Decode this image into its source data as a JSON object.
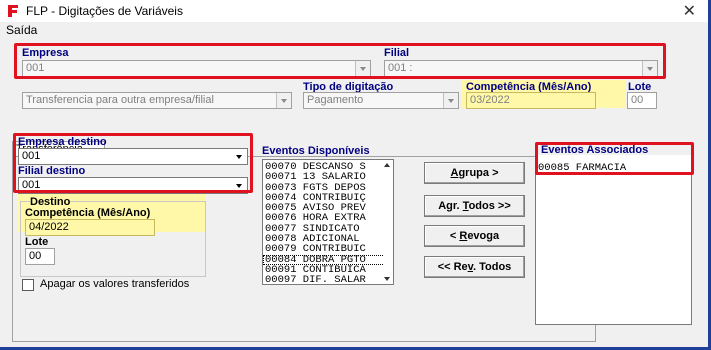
{
  "window": {
    "title": "FLP - Digitações de Variáveis",
    "close_glyph": "✕"
  },
  "menu": {
    "items": [
      "Saída"
    ]
  },
  "empresa": {
    "label": "Empresa",
    "value": "001"
  },
  "filial": {
    "label": "Filial",
    "value": "001 :"
  },
  "operacao": {
    "value": "Transferencia para outra empresa/filial"
  },
  "tipo_digitacao": {
    "label": "Tipo de digitação",
    "value": "Pagamento"
  },
  "competencia": {
    "label": "Competência (Mês/Ano)",
    "value": "03/2022"
  },
  "lote": {
    "label": "Lote",
    "value": "00"
  },
  "tab": {
    "label": "Transferência"
  },
  "empresa_destino": {
    "label": "Empresa destino",
    "value": "001"
  },
  "filial_destino": {
    "label": "Filial destino",
    "value": "001"
  },
  "destino": {
    "group_label": "Destino",
    "competencia_label": "Competência (Mês/Ano)",
    "competencia_value": "04/2022",
    "lote_label": "Lote",
    "lote_value": "00"
  },
  "apagar": {
    "label": "Apagar os valores transferidos",
    "checked": false
  },
  "eventos_disponiveis": {
    "label": "Eventos Disponíveis",
    "items": [
      "00070 DESCANSO S",
      "00071 13 SALARIO",
      "00073 FGTS DEPOS",
      "00074 CONTRIBUIÇ",
      "00075 AVISO PREV",
      "00076 HORA EXTRA",
      "00077 SINDICATO",
      "00078 ADICIONAL",
      "00079 CONTRIBUIC",
      "00084 DOBRA PGTO",
      "00091 CONTIBUICA",
      "00097 DIF. SALAR"
    ],
    "selected_index": 9
  },
  "buttons": {
    "agrupa": {
      "pre": "",
      "key": "A",
      "post": "grupa >"
    },
    "agrupa_todos": {
      "pre": "Agr. ",
      "key": "T",
      "post": "odos >>"
    },
    "revoga": {
      "pre": "< ",
      "key": "R",
      "post": "evoga"
    },
    "revoga_todos": {
      "pre": "<< Re",
      "key": "v",
      "post": ". Todos"
    }
  },
  "eventos_associados": {
    "label": "Eventos Associados",
    "items": [
      "00085 FARMACIA"
    ]
  },
  "colors": {
    "title_accent": "#e0121f",
    "label_blue": "#000080",
    "highlight": "#fff8a8",
    "frame_blue": "#1f3f99"
  }
}
